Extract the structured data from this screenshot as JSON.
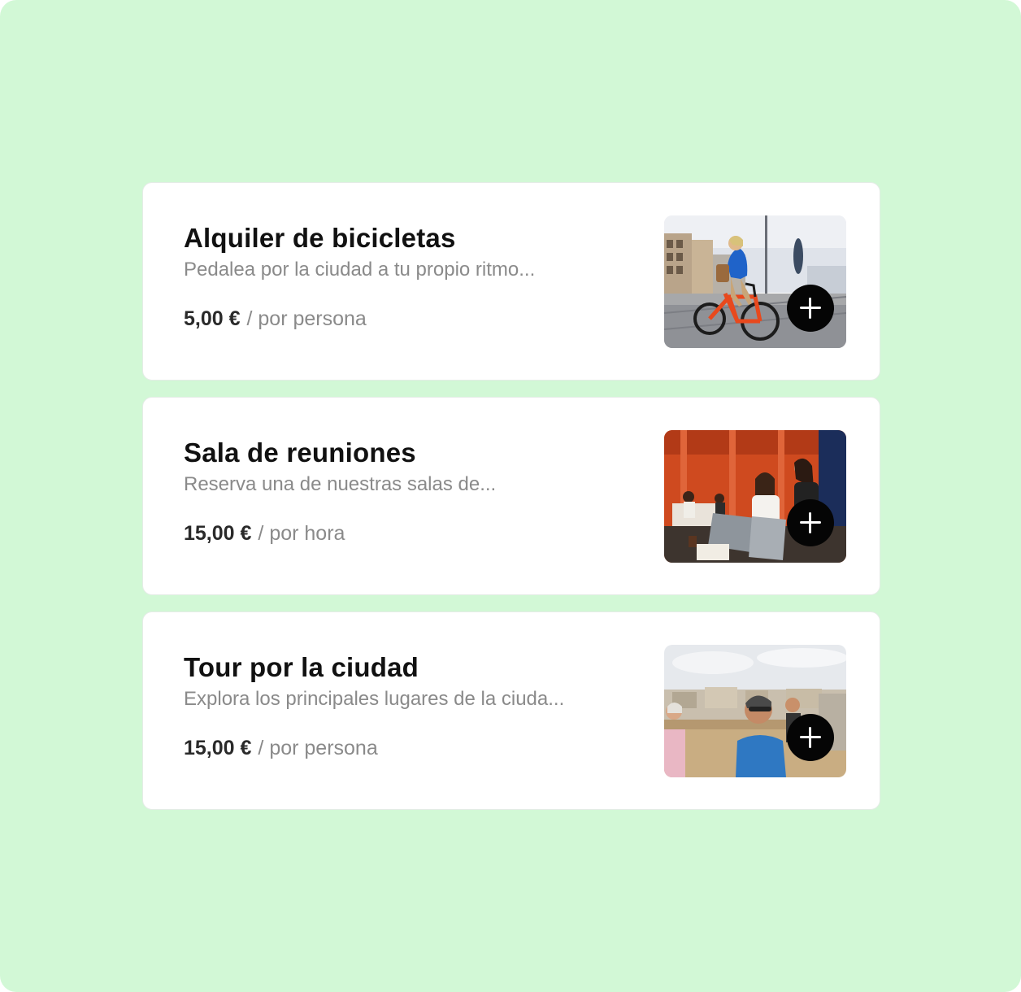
{
  "colors": {
    "background": "#d2f8d6",
    "card": "#ffffff",
    "title": "#111111",
    "muted": "#8a8a8a",
    "price": "#2a2a2a",
    "button": "#050505"
  },
  "services": [
    {
      "title": "Alquiler de bicicletas",
      "description": "Pedalea por la ciudad a tu propio ritmo...",
      "price": "5,00 €",
      "unit": "/ por persona",
      "image": "bicycle-rider-photo",
      "action_icon": "plus-icon"
    },
    {
      "title": "Sala de reuniones",
      "description": "Reserva una de nuestras salas de...",
      "price": "15,00 €",
      "unit": "/ por hora",
      "image": "meeting-room-photo",
      "action_icon": "plus-icon"
    },
    {
      "title": "Tour por la ciudad",
      "description": "Explora los principales lugares de la ciuda...",
      "price": "15,00 €",
      "unit": "/ por persona",
      "image": "city-tour-photo",
      "action_icon": "plus-icon"
    }
  ]
}
